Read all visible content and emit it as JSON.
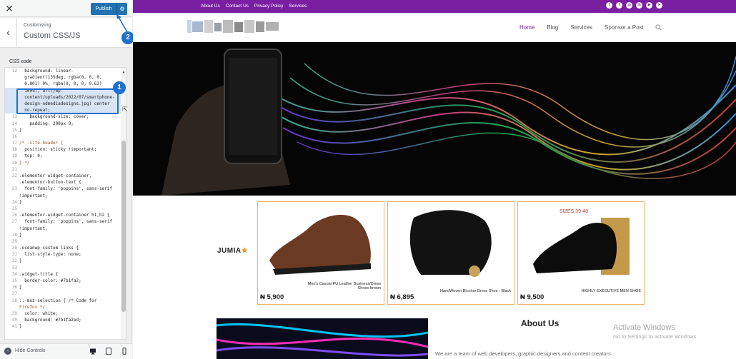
{
  "customizer": {
    "close_icon": "close-icon",
    "publish_label": "Publish",
    "breadcrumb": "Customizing",
    "section_title": "Custom CSS/JS",
    "css_label": "CSS code",
    "hide_controls_label": "Hide Controls",
    "annotations": {
      "badge_1": "1",
      "badge_2": "2"
    },
    "code_lines": [
      {
        "n": "12",
        "t": "  background: linear-"
      },
      {
        "n": "",
        "t": "  gradient(135deg, rgba(0, 0, 0,"
      },
      {
        "n": "",
        "t": "  0.801) 0%, rgba(0, 0, 0, 0.63)"
      },
      {
        "n": "",
        "t": "  100%), url(/wp-"
      },
      {
        "n": "",
        "t": "  content/uploads/2022/07/smartphone-"
      },
      {
        "n": "",
        "t": "  design-ndmediadesigns.jpg) center"
      },
      {
        "n": "",
        "t": "  no-repeat;"
      },
      {
        "n": "13",
        "t": "    background-size: cover;"
      },
      {
        "n": "14",
        "t": "    padding: 200px 0;"
      },
      {
        "n": "15",
        "t": "}"
      },
      {
        "n": "16",
        "t": ""
      },
      {
        "n": "17",
        "t": "/* .site-header {"
      },
      {
        "n": "18",
        "t": "  position: sticky !important;"
      },
      {
        "n": "19",
        "t": "  top: 0;"
      },
      {
        "n": "20",
        "t": "} */"
      },
      {
        "n": "21",
        "t": ""
      },
      {
        "n": "22",
        "t": ".elementor-widget-container,"
      },
      {
        "n": "",
        "t": ".elementor-button-text {"
      },
      {
        "n": "23",
        "t": "  font-family: 'poppins', sans-serif"
      },
      {
        "n": "",
        "t": "!important;"
      },
      {
        "n": "24",
        "t": "}"
      },
      {
        "n": "25",
        "t": ""
      },
      {
        "n": "26",
        "t": ".elementor-widget-container h1,h2 {"
      },
      {
        "n": "27",
        "t": "  font-family: 'poppins', sans-serif"
      },
      {
        "n": "",
        "t": "!important;"
      },
      {
        "n": "28",
        "t": "}"
      },
      {
        "n": "29",
        "t": ""
      },
      {
        "n": "30",
        "t": ".oceanwp-custom-links {"
      },
      {
        "n": "31",
        "t": "  list-style-type: none;"
      },
      {
        "n": "32",
        "t": "}"
      },
      {
        "n": "33",
        "t": ""
      },
      {
        "n": "34",
        "t": ".widget-title {"
      },
      {
        "n": "35",
        "t": "  border-color: #7b1fa2;"
      },
      {
        "n": "36",
        "t": "}"
      },
      {
        "n": "37",
        "t": ""
      },
      {
        "n": "38",
        "t": "::-moz-selection { /* Code for"
      },
      {
        "n": "",
        "t": "Firefox */"
      },
      {
        "n": "39",
        "t": "  color: white;"
      },
      {
        "n": "40",
        "t": "  background: #7b1fa2ed;"
      },
      {
        "n": "41",
        "t": "}"
      }
    ]
  },
  "site": {
    "top_links": [
      "About Us",
      "Contact Us",
      "Privacy Policy",
      "Services"
    ],
    "social_icons": [
      "twitter-icon",
      "facebook-icon",
      "instagram-icon",
      "linkedin-icon",
      "youtube-icon",
      "telegram-icon"
    ],
    "nav": [
      {
        "label": "Home",
        "active": true
      },
      {
        "label": "Blog",
        "active": false
      },
      {
        "label": "Services",
        "active": false
      },
      {
        "label": "Sponsor a Post",
        "active": false
      }
    ],
    "brand_color": "#7b1fa2",
    "ad": {
      "brand": "JUMIA",
      "products": [
        {
          "name": "Men's Casual PU Leather Business/Dress Shoes-brown",
          "price": "₦ 5,900"
        },
        {
          "name": "HandWoven Blucher Dress Shoe - Black",
          "price": "₦ 6,895"
        },
        {
          "name": "HIGHLY EXECUTIVE MEN SHOE",
          "price": "₦ 9,500",
          "size_badge": "SIZES 39-48"
        }
      ]
    },
    "about_title": "About Us",
    "about_text": "We are a team of web developers, graphic designers and content creators",
    "activate_title": "Activate Windows",
    "activate_sub": "Go to Settings to activate Windows."
  }
}
